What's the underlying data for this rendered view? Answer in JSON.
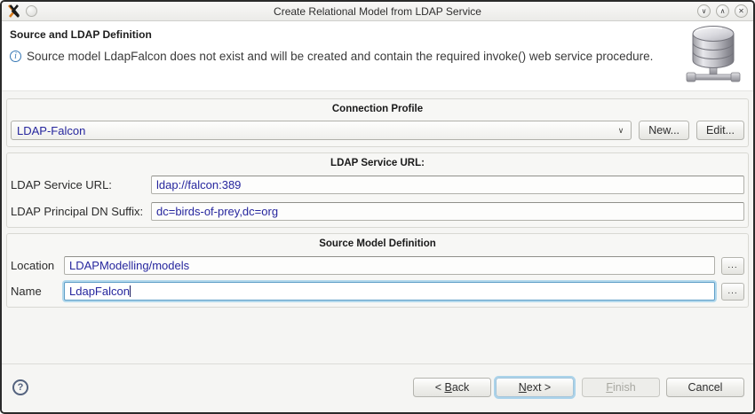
{
  "titlebar": {
    "title": "Create Relational Model from LDAP Service",
    "minimize_glyph": "∨",
    "maximize_glyph": "∧",
    "close_glyph": "✕"
  },
  "header": {
    "title": "Source and LDAP Definition",
    "info_glyph": "i",
    "message": "Source model LdapFalcon does not exist and will be created and contain the required invoke() web service procedure."
  },
  "connection_profile": {
    "group_title": "Connection Profile",
    "selected_value": "LDAP-Falcon",
    "chevron_glyph": "∨",
    "new_button": "New...",
    "edit_button": "Edit..."
  },
  "ldap_service": {
    "group_title": "LDAP Service URL:",
    "url_label": "LDAP Service URL:",
    "url_value": "ldap://falcon:389",
    "dn_label": "LDAP Principal DN Suffix:",
    "dn_value": "dc=birds-of-prey,dc=org"
  },
  "source_model": {
    "group_title": "Source Model Definition",
    "location_label": "Location",
    "location_value": "LDAPModelling/models",
    "name_label": "Name",
    "name_value": "LdapFalcon",
    "browse_button": "..."
  },
  "footer": {
    "help_glyph": "?",
    "back": {
      "label": "< Back",
      "mnemonic": "B"
    },
    "next": {
      "label": "Next >",
      "mnemonic": "N"
    },
    "finish": {
      "label": "Finish",
      "mnemonic": "F"
    },
    "cancel": {
      "label": "Cancel",
      "mnemonic": ""
    }
  },
  "colors": {
    "field_text": "#26269e",
    "focus_ring": "#b2d8ec",
    "info_icon_blue": "#3878b4",
    "body_bg": "#f5f5f3",
    "window_border": "#2a2a2a"
  }
}
